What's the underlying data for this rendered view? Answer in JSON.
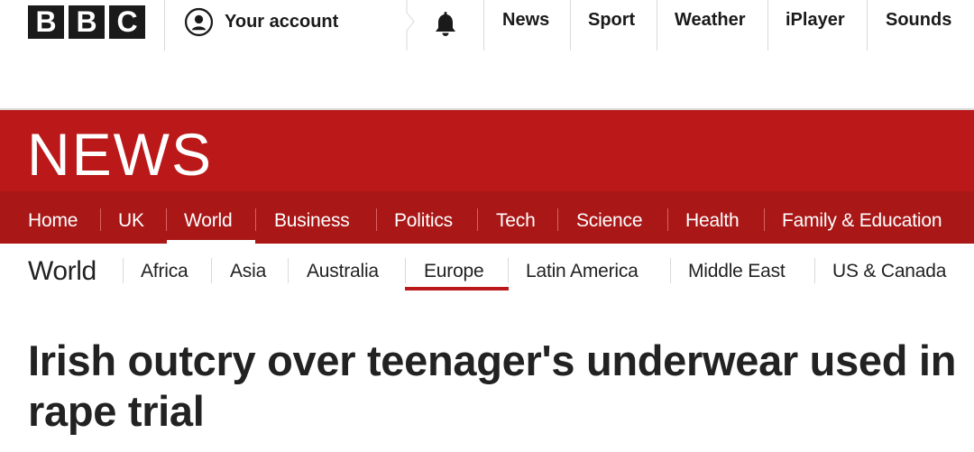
{
  "bbc_logo": [
    "B",
    "B",
    "C"
  ],
  "account": {
    "label": "Your account"
  },
  "top_nav": [
    "News",
    "Sport",
    "Weather",
    "iPlayer",
    "Sounds"
  ],
  "news_wordmark": "NEWS",
  "news_nav": {
    "items": [
      "Home",
      "UK",
      "World",
      "Business",
      "Politics",
      "Tech",
      "Science",
      "Health",
      "Family & Education"
    ],
    "active": "World"
  },
  "sub_nav": {
    "title": "World",
    "items": [
      "Africa",
      "Asia",
      "Australia",
      "Europe",
      "Latin America",
      "Middle East",
      "US & Canada"
    ],
    "active": "Europe"
  },
  "headline": "Irish outcry over teenager's underwear used in rape trial",
  "colors": {
    "brand_red": "#bb1919",
    "nav_red": "#a91717",
    "logo_black": "#1a1a1a"
  }
}
